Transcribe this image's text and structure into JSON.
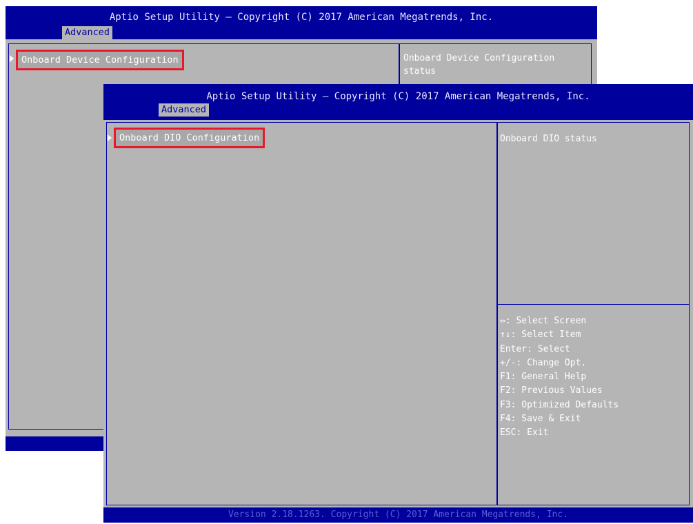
{
  "back": {
    "title": "Aptio Setup Utility – Copyright (C) 2017 American Megatrends, Inc.",
    "tab": "Advanced",
    "menu_item": "Onboard Device Configuration",
    "help_text": "Onboard Device Configuration status"
  },
  "front": {
    "title": "Aptio Setup Utility – Copyright (C) 2017 American Megatrends, Inc.",
    "tab": "Advanced",
    "menu_item": "Onboard DIO Configuration",
    "help_text": "Onboard DIO status",
    "keys": [
      "↔: Select Screen",
      "↑↓: Select Item",
      "Enter: Select",
      "+/-: Change Opt.",
      "F1: General Help",
      "F2: Previous Values",
      "F3: Optimized Defaults",
      "F4: Save & Exit",
      "ESC: Exit"
    ],
    "footer": "Version 2.18.1263. Copyright (C) 2017 American Megatrends, Inc."
  },
  "colors": {
    "header_bg": "#00009c",
    "panel_bg": "#b5b5b5",
    "highlight_border": "#e8182a"
  }
}
